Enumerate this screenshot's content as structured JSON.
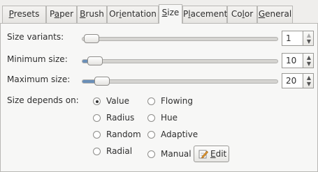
{
  "tabs": [
    {
      "label": "Presets",
      "mnemonic": "P"
    },
    {
      "label": "Paper",
      "mnemonic": "a"
    },
    {
      "label": "Brush",
      "mnemonic": "B"
    },
    {
      "label": "Orientation",
      "mnemonic": "i"
    },
    {
      "label": "Size",
      "mnemonic": "S"
    },
    {
      "label": "Placement",
      "mnemonic": "l"
    },
    {
      "label": "Color",
      "mnemonic": "l"
    },
    {
      "label": "General",
      "mnemonic": "G"
    }
  ],
  "active_tab": "Size",
  "size": {
    "variants_label": "Size variants:",
    "variants_value": "1",
    "min_label": "Minimum size:",
    "min_value": "10",
    "max_label": "Maximum size:",
    "max_value": "20",
    "depends_label": "Size depends on:",
    "options": [
      {
        "label": "Value",
        "selected": true
      },
      {
        "label": "Flowing",
        "selected": false
      },
      {
        "label": "Radius",
        "selected": false
      },
      {
        "label": "Hue",
        "selected": false
      },
      {
        "label": "Random",
        "selected": false
      },
      {
        "label": "Adaptive",
        "selected": false
      },
      {
        "label": "Radial",
        "selected": false
      },
      {
        "label": "Manual",
        "selected": false
      }
    ],
    "edit_label": "Edit",
    "edit_mnemonic": "E"
  },
  "colors": {
    "accent": "#6a8fb8",
    "background": "#efeeec",
    "panel": "#f7f7f6"
  }
}
